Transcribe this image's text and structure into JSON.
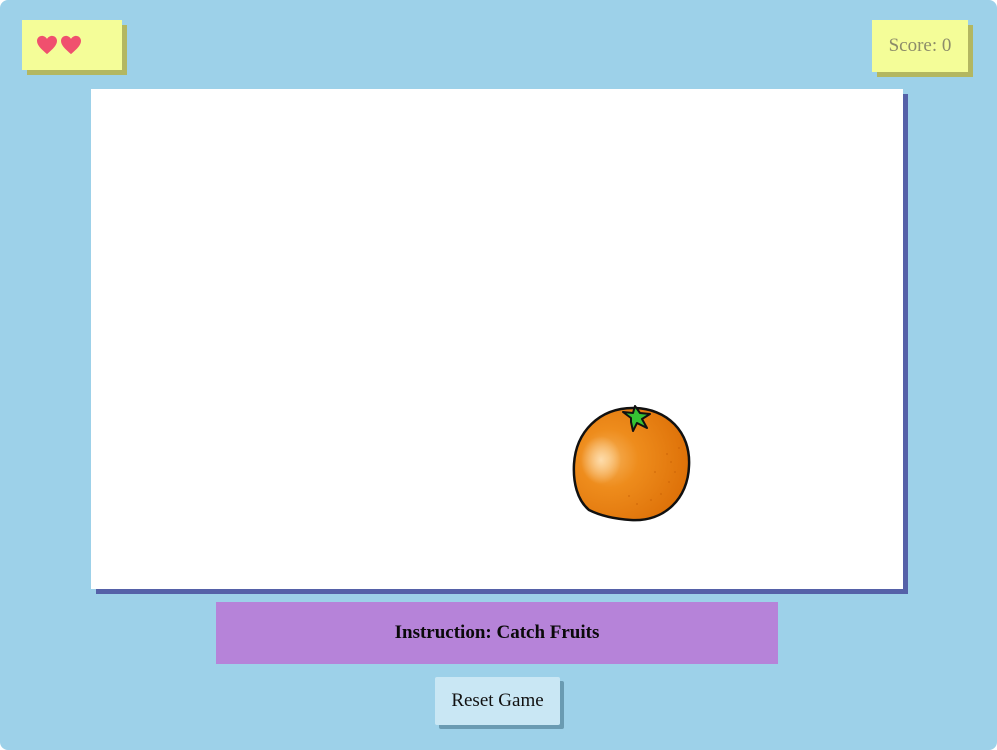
{
  "hud": {
    "lives": {
      "count": 2,
      "icon": "heart-icon",
      "color": "#f0506e"
    },
    "score_text": "Score: 0",
    "score_value": 0
  },
  "game": {
    "fruits": [
      {
        "type": "orange",
        "icon": "orange-icon",
        "color": "#e87d10"
      }
    ]
  },
  "instruction_text": "Instruction: Catch Fruits",
  "reset_label": "Reset Game",
  "colors": {
    "background": "#9dd1e9",
    "hud_box": "#f4fd98",
    "instruction_bar": "#b683d9",
    "game_area_shadow": "#5561a8"
  }
}
